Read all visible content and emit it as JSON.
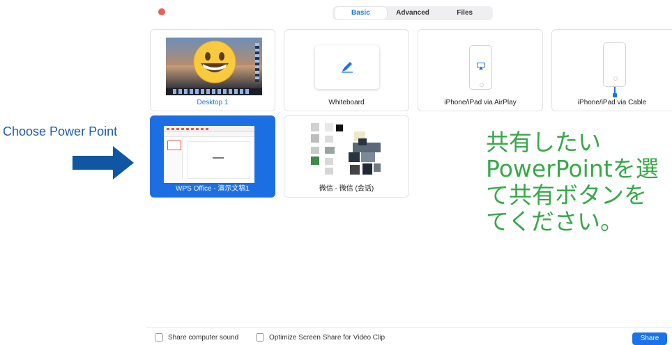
{
  "annotation": {
    "label": "Choose Power Point",
    "arrow_color": "#0f56a4"
  },
  "tabs": [
    {
      "label": "Basic",
      "active": true
    },
    {
      "label": "Advanced",
      "active": false
    },
    {
      "label": "Files",
      "active": false
    }
  ],
  "tiles": {
    "desktop": {
      "label": "Desktop 1",
      "overlay_icon": "grinning-face-icon"
    },
    "whiteboard": {
      "label": "Whiteboard",
      "icon": "pencil-icon"
    },
    "airplay": {
      "label": "iPhone/iPad via AirPlay",
      "icon": "airplay-icon"
    },
    "cable": {
      "label": "iPhone/iPad via Cable",
      "icon": "cable-icon"
    },
    "wps": {
      "label": "WPS Office - 演示文稿1",
      "selected": true
    },
    "wechat": {
      "label": "微信 - 微信 (会话)"
    }
  },
  "instruction": {
    "line1": "共有したい",
    "line2": "PowerPointを選",
    "line3": "て共有ボタンを",
    "line4": "てください。"
  },
  "bottom": {
    "share_sound_label": "Share computer sound",
    "optimize_label": "Optimize Screen Share for Video Clip",
    "share_button": "Share"
  },
  "colors": {
    "accent": "#1a73e8",
    "selected_tile": "#1b6fe3",
    "annotation_text": "#1f5fae",
    "instruction_text": "#38a84a",
    "close_dot": "#ef5b55"
  }
}
